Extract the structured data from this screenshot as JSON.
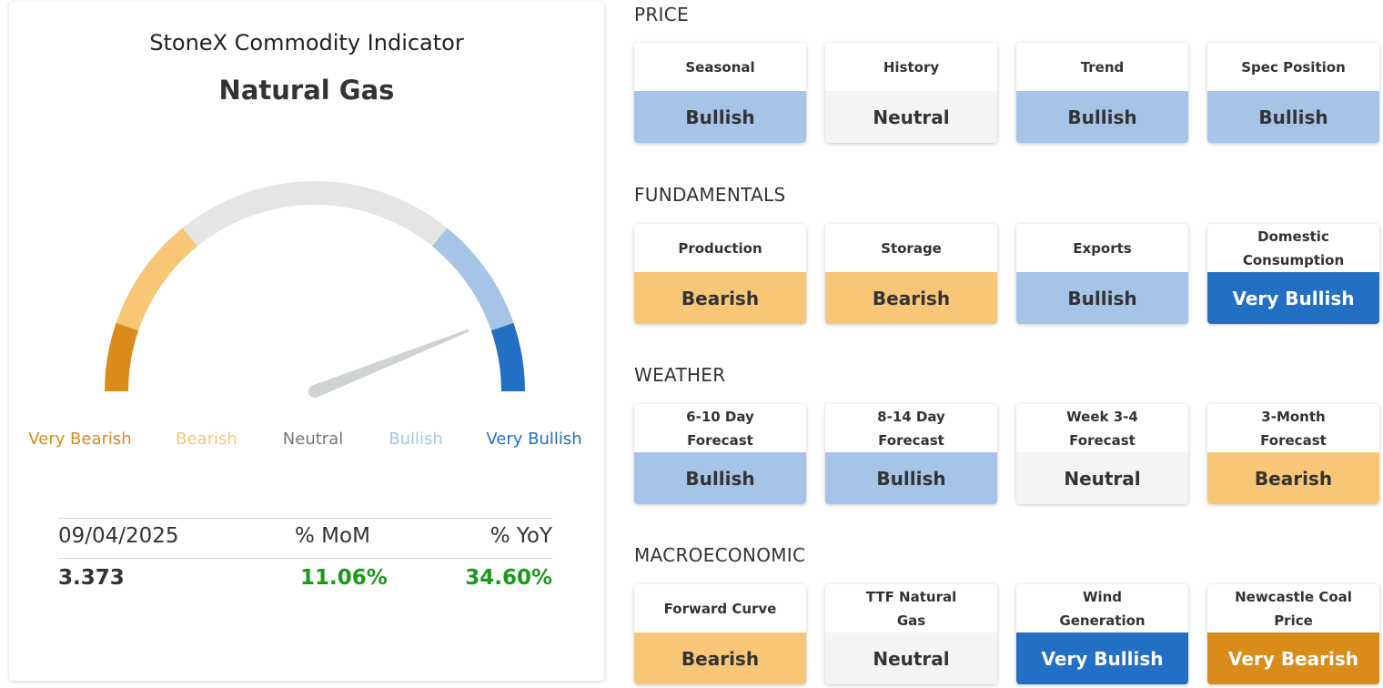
{
  "indicator": {
    "title": "StoneX Commodity Indicator",
    "commodity": "Natural Gas",
    "gauge_level": 0.88,
    "legend": [
      "Very Bearish",
      "Bearish",
      "Neutral",
      "Bullish",
      "Very Bullish"
    ],
    "stats": {
      "date": "09/04/2025",
      "mom_label": "% MoM",
      "yoy_label": "% YoY",
      "price": "3.373",
      "mom": "11.06%",
      "yoy": "34.60%"
    }
  },
  "colors": {
    "very_bearish": "#d98c19",
    "bearish": "#f7c677",
    "neutral": "#e4e6e6",
    "bullish": "#a6c4e7",
    "very_bullish": "#226fc4",
    "positive": "#1a9a1a",
    "needle": "#cfd3d4"
  },
  "sections": [
    {
      "title": "PRICE",
      "tiles": [
        {
          "name": "Seasonal",
          "status": "Bullish"
        },
        {
          "name": "History",
          "status": "Neutral"
        },
        {
          "name": "Trend",
          "status": "Bullish"
        },
        {
          "name": "Spec Position",
          "status": "Bullish"
        }
      ]
    },
    {
      "title": "FUNDAMENTALS",
      "tiles": [
        {
          "name": "Production",
          "status": "Bearish"
        },
        {
          "name": "Storage",
          "status": "Bearish"
        },
        {
          "name": "Exports",
          "status": "Bullish"
        },
        {
          "name": "Domestic Consumption",
          "status": "Very Bullish"
        }
      ]
    },
    {
      "title": "WEATHER",
      "tiles": [
        {
          "name": "6-10 Day Forecast",
          "status": "Bullish"
        },
        {
          "name": "8-14 Day Forecast",
          "status": "Bullish"
        },
        {
          "name": "Week 3-4 Forecast",
          "status": "Neutral"
        },
        {
          "name": "3-Month Forecast",
          "status": "Bearish"
        }
      ]
    },
    {
      "title": "MACROECONOMIC",
      "tiles": [
        {
          "name": "Forward Curve",
          "status": "Bearish"
        },
        {
          "name": "TTF Natural Gas",
          "status": "Neutral"
        },
        {
          "name": "Wind Generation",
          "status": "Very Bullish"
        },
        {
          "name": "Newcastle Coal Price",
          "status": "Very Bearish"
        }
      ]
    }
  ]
}
